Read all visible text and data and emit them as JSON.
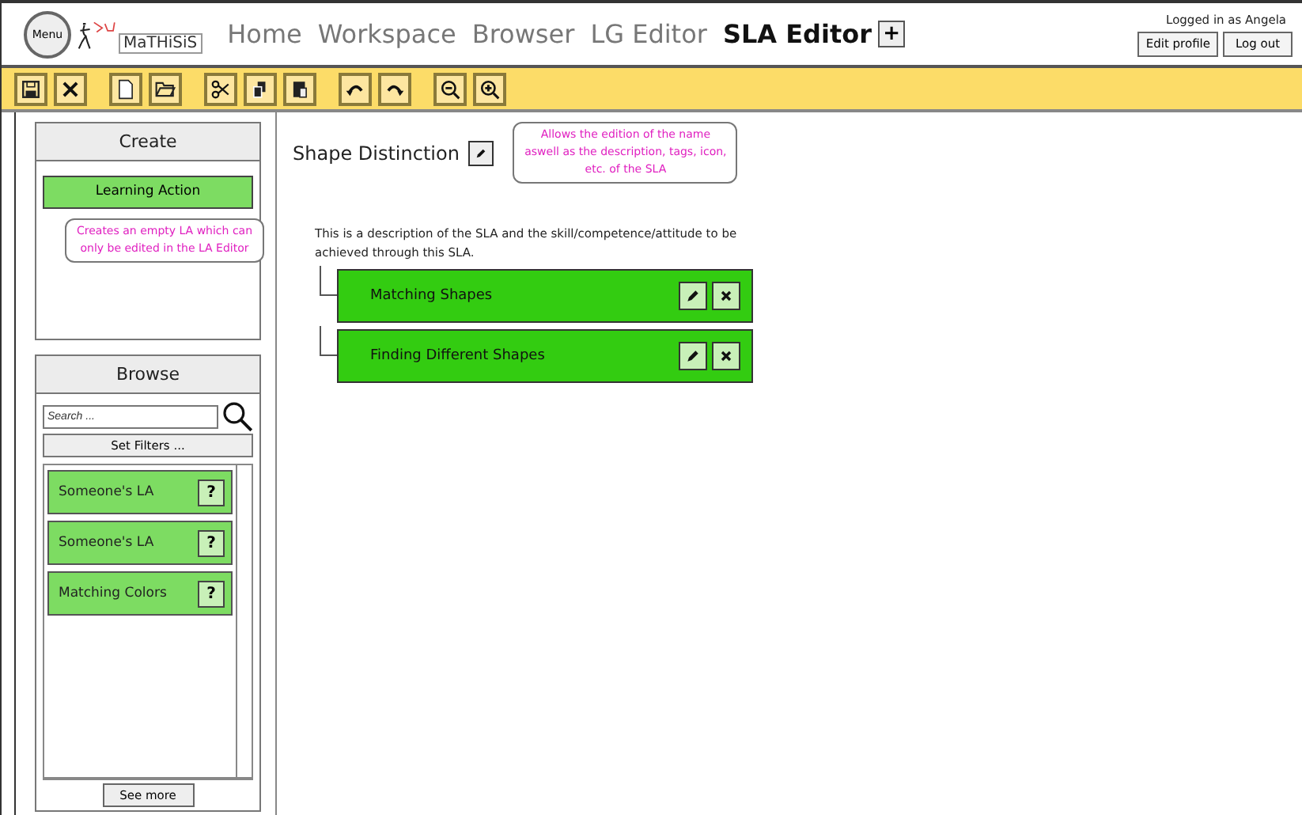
{
  "header": {
    "menu_button": "Menu",
    "logo": "MaTHiSiS",
    "nav": [
      {
        "label": "Home",
        "selected": false
      },
      {
        "label": "Workspace",
        "selected": false
      },
      {
        "label": "Browser",
        "selected": false
      },
      {
        "label": "LG Editor",
        "selected": false
      },
      {
        "label": "SLA Editor",
        "selected": true
      }
    ],
    "add_tab": "+",
    "user_status": "Logged in as Angela",
    "user_buttons": [
      "Edit profile",
      "Log out"
    ]
  },
  "create": {
    "title": "Create",
    "button": "Learning Action",
    "tooltip": "Creates an empty LA which can only be edited in the LA Editor"
  },
  "browse": {
    "title": "Browse",
    "search": {
      "placeholder": "Search ..."
    },
    "filter_button": "Set Filters ...",
    "items": [
      {
        "label": "Someone's LA",
        "help": "?"
      },
      {
        "label": "Someone's LA",
        "help": "?"
      },
      {
        "label": "Matching Colors",
        "help": "?"
      }
    ],
    "more_button": "See more"
  },
  "sla": {
    "title": "Shape Distinction",
    "tooltip": "Allows the edition of the name aswell as the description, tags, icon, etc. of the SLA",
    "description": "This is a description of the SLA and the skill/competence/attitude to be achieved through this SLA.",
    "children": [
      {
        "label": "Matching Shapes"
      },
      {
        "label": "Finding Different Shapes"
      }
    ]
  }
}
